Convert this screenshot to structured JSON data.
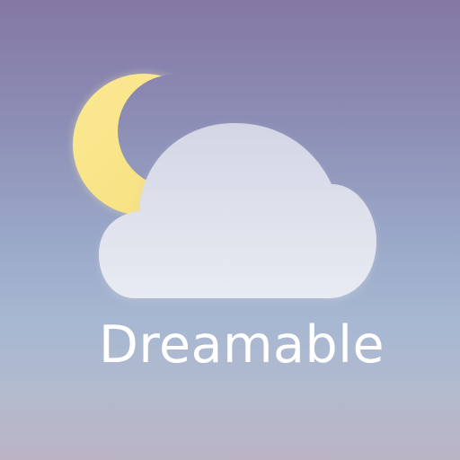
{
  "app": {
    "name": "Dreamable",
    "icon": "moon-and-cloud",
    "colors": {
      "background_top": "#8478a4",
      "background_middle": "#9aa8c8",
      "background_bottom": "#bbb4c6",
      "moon": "#f9e588",
      "cloud": "#e2e5ee",
      "label": "#ffffff"
    }
  }
}
